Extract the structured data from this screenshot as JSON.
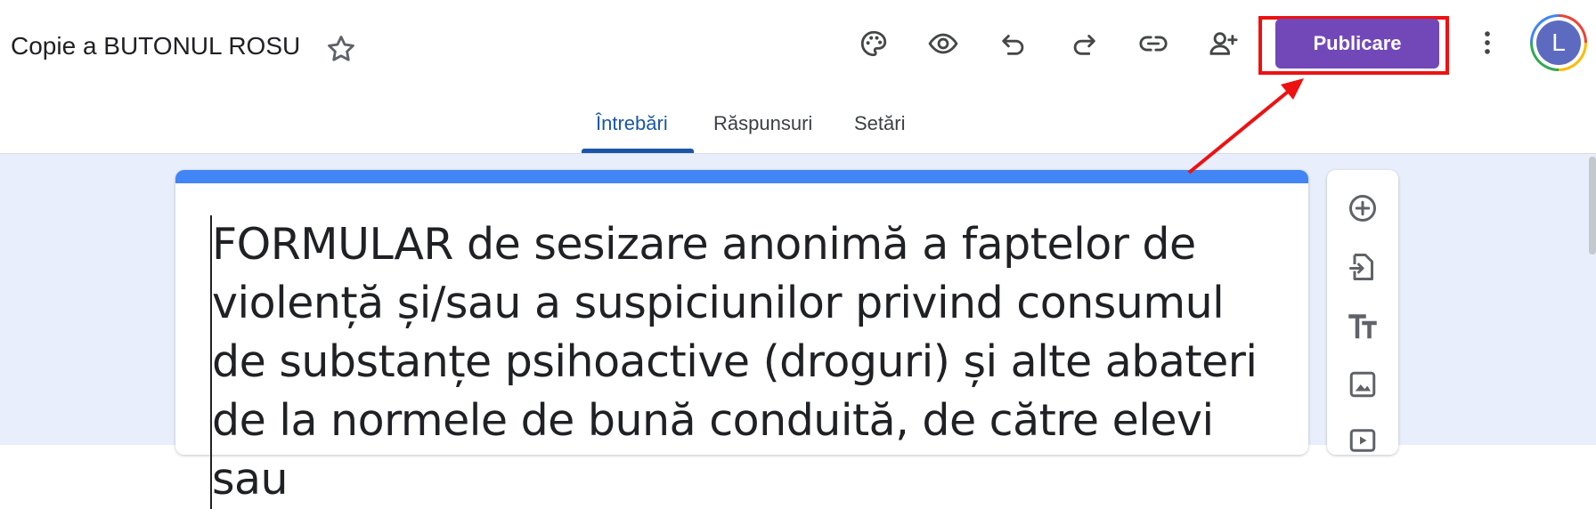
{
  "header": {
    "title": "Copie a BUTONUL ROSU",
    "publish_label": "Publicare",
    "avatar_letter": "L",
    "toolbar_icons": [
      "palette-icon",
      "eye-icon",
      "undo-icon",
      "redo-icon",
      "link-icon",
      "add-person-icon"
    ]
  },
  "tabs": [
    {
      "label": "Întrebări",
      "active": true
    },
    {
      "label": "Răspunsuri",
      "active": false
    },
    {
      "label": "Setări",
      "active": false
    }
  ],
  "form": {
    "title": "FORMULAR de sesizare anonimă a faptelor de violență și/sau a suspiciunilor privind consumul de substanțe psihoactive (droguri) și alte abateri de la normele de bună conduită, de către elevi sau"
  },
  "side_toolbar_icons": [
    "add-question-icon",
    "import-questions-icon",
    "add-title-icon",
    "add-image-icon",
    "add-video-icon"
  ],
  "colors": {
    "accent": "#4285f4",
    "publish": "#7248b9",
    "active_tab": "#1a56a8",
    "highlight": "#ee1111",
    "canvas": "#e8eefb"
  }
}
